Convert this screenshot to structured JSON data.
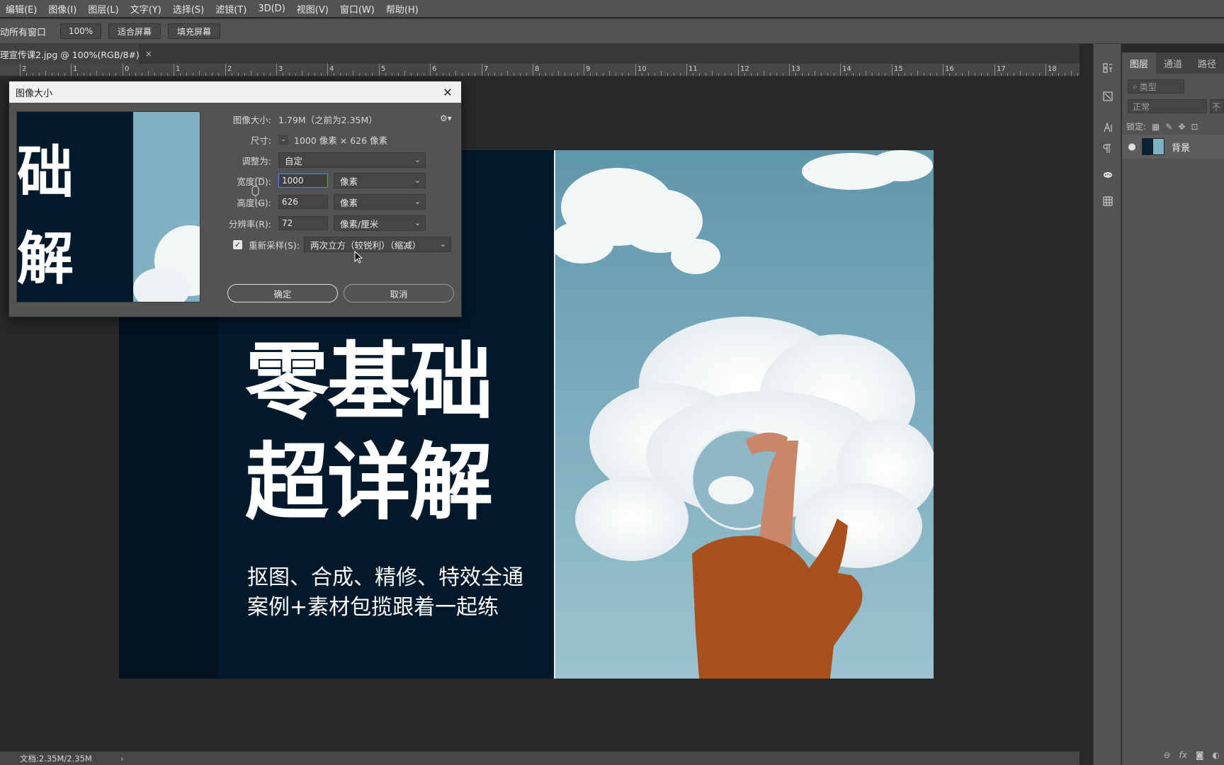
{
  "menu": [
    "编辑(E)",
    "图像(I)",
    "图层(L)",
    "文字(Y)",
    "选择(S)",
    "滤镜(T)",
    "3D(D)",
    "视图(V)",
    "窗口(W)",
    "帮助(H)"
  ],
  "options": {
    "scroll_all_label": "动所有窗口",
    "zoom_value": "100%",
    "fit_screen": "适合屏幕",
    "fill_screen": "填充屏幕"
  },
  "document_tab": {
    "title": "理宣传课2.jpg @ 100%(RGB/8#)",
    "close": "×"
  },
  "ruler": {
    "labels": [
      "2",
      "1",
      "0",
      "1",
      "2",
      "3",
      "4",
      "5",
      "6",
      "7",
      "8",
      "9",
      "10",
      "11",
      "12",
      "13",
      "14",
      "15",
      "16",
      "17",
      "18"
    ]
  },
  "poster": {
    "headline_line1": "零基础",
    "headline_line2": "超详解",
    "sub_line1": "抠图、合成、精修、特效全通",
    "sub_line2": "案例+素材包揽跟着一起练"
  },
  "dialog": {
    "title": "图像大小",
    "close": "✕",
    "preview_char1": "础",
    "preview_char2": "解",
    "image_size_label": "图像大小:",
    "image_size_value": "1.79M（之前为2.35M）",
    "dimensions_label": "尺寸:",
    "dimensions_value": "1000 像素 × 626 像素",
    "fit_label": "调整为:",
    "fit_value": "自定",
    "width_label": "宽度(D):",
    "width_value": "1000",
    "width_unit": "像素",
    "height_label": "高度(G):",
    "height_value": "626",
    "height_unit": "像素",
    "resolution_label": "分辨率(R):",
    "resolution_value": "72",
    "resolution_unit": "像素/厘米",
    "resample_label": "重新采样(S):",
    "resample_value": "两次立方（较锐利）（缩减）",
    "resample_checked": true,
    "ok_label": "确定",
    "cancel_label": "取消"
  },
  "panel": {
    "tabs": [
      "图层",
      "通道",
      "路径"
    ],
    "filter_placeholder": "类型",
    "blend_mode": "正常",
    "opacity_label": "不",
    "lock_label": "锁定:",
    "layer_name": "背景"
  },
  "status": {
    "doc_info": "文档:2.35M/2.35M",
    "arrow": "›"
  },
  "colors": {
    "ui_bg": "#535353",
    "canvas_bg": "#282828",
    "poster_bg": "#02182b",
    "sky": "#7fb1c0",
    "shirt": "#a8511f",
    "focus_blue": "#4b8ad6"
  }
}
